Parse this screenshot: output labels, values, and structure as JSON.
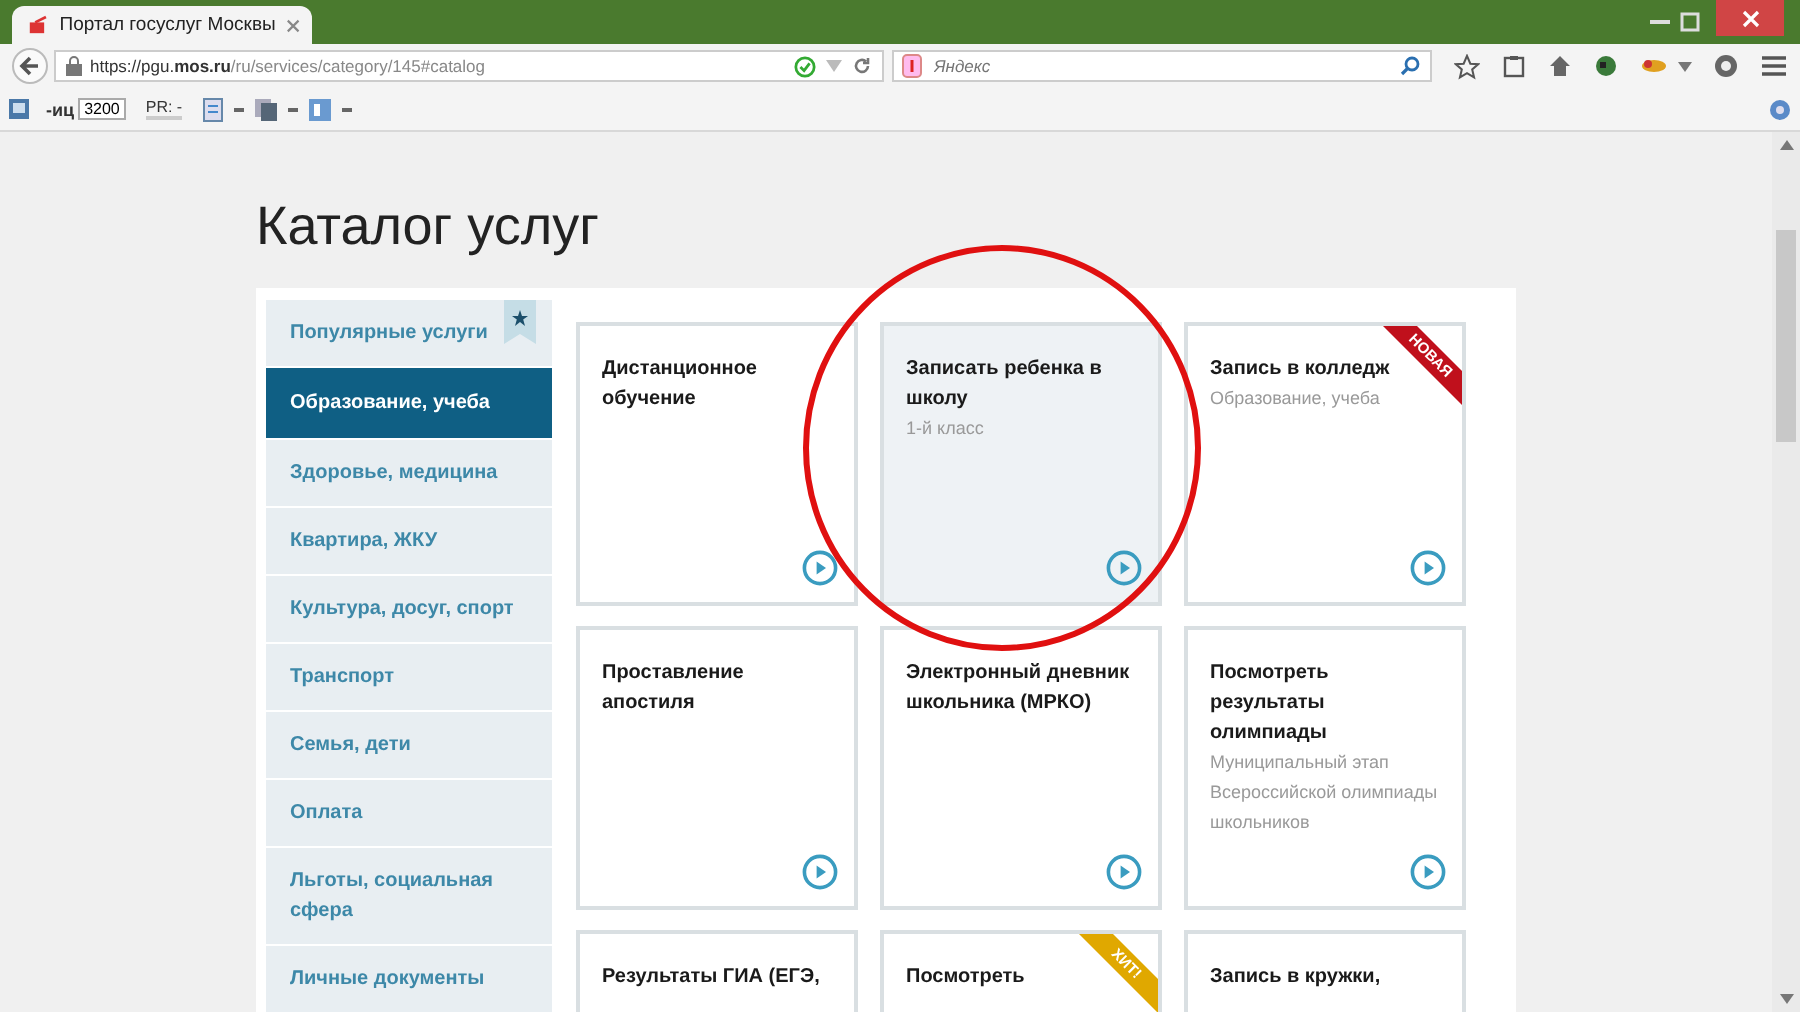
{
  "browser": {
    "tab_title": "Портал госуслуг Москвы",
    "url_prefix": "https://pgu.",
    "url_domain": "mos.ru",
    "url_path": "/ru/services/category/145#catalog",
    "search_placeholder": "Яндекс",
    "toolbar": {
      "yandex_short": "-иц",
      "tic_value": "3200",
      "pr_label": "PR: -"
    }
  },
  "page": {
    "title": "Каталог услуг",
    "sidebar": {
      "items": [
        {
          "label": "Популярные услуги",
          "selected": false,
          "kind": "starred"
        },
        {
          "label": "Образование, учеба",
          "selected": true,
          "kind": "plain"
        },
        {
          "label": "Здоровье, медицина",
          "selected": false,
          "kind": "plain"
        },
        {
          "label": "Квартира, ЖКУ",
          "selected": false,
          "kind": "plain"
        },
        {
          "label": "Культура, досуг, спорт",
          "selected": false,
          "kind": "plain"
        },
        {
          "label": "Транспорт",
          "selected": false,
          "kind": "plain"
        },
        {
          "label": "Семья, дети",
          "selected": false,
          "kind": "plain"
        },
        {
          "label": "Оплата",
          "selected": false,
          "kind": "plain"
        },
        {
          "label": "Льготы, социальная сфера",
          "selected": false,
          "kind": "plain"
        },
        {
          "label": "Личные документы",
          "selected": false,
          "kind": "plain"
        }
      ]
    },
    "cards": [
      {
        "title": "Дистанционное обучение",
        "highlighted": false
      },
      {
        "title": "Записать ребенка в школу",
        "subtitle": "1-й класс",
        "highlighted": true,
        "annotated": true
      },
      {
        "title": "Запись в колледж",
        "subtitle": "Образование, учеба",
        "highlighted": false,
        "ribbon": {
          "text": "НОВАЯ",
          "color": "#c0101c"
        }
      },
      {
        "title": "Проставление апостиля",
        "highlighted": false
      },
      {
        "title": "Электронный дневник школьника (МРКО)",
        "highlighted": false
      },
      {
        "title": "Посмотреть результаты олимпиады",
        "subtitle": "Муниципальный этап Всероссийской олимпиады школьников",
        "highlighted": false
      },
      {
        "title": "Результаты ГИА (ЕГЭ,",
        "highlighted": false
      },
      {
        "title": "Посмотреть",
        "highlighted": false,
        "ribbon": {
          "text": "ХИТ!",
          "color": "#e0a800"
        }
      },
      {
        "title": "Запись в кружки,",
        "highlighted": false
      }
    ]
  }
}
